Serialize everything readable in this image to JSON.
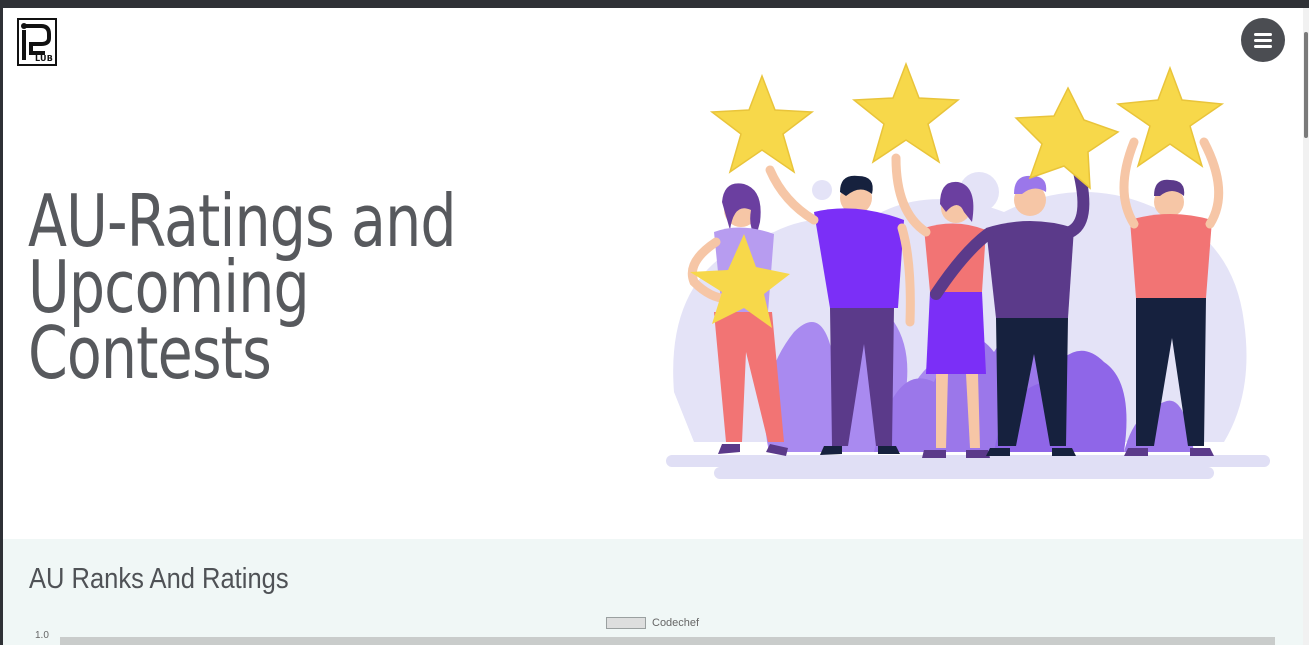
{
  "header": {
    "logo_text": "LUB",
    "menu_icon": "hamburger-icon"
  },
  "hero": {
    "title_line1": "AU-Ratings and",
    "title_line2": "Upcoming",
    "title_line3": "Contests",
    "illustration": "people-holding-stars-illustration"
  },
  "ranks_section": {
    "title": "AU Ranks And Ratings"
  },
  "chart_data": {
    "type": "bar",
    "series": [
      {
        "name": "Codechef",
        "color": "#dddede"
      }
    ],
    "yticks": [
      "1.0"
    ]
  },
  "colors": {
    "star": "#f7d84a",
    "accent_purple": "#7b2ff7",
    "section_bg": "#f0f7f6",
    "title": "#57595d"
  }
}
